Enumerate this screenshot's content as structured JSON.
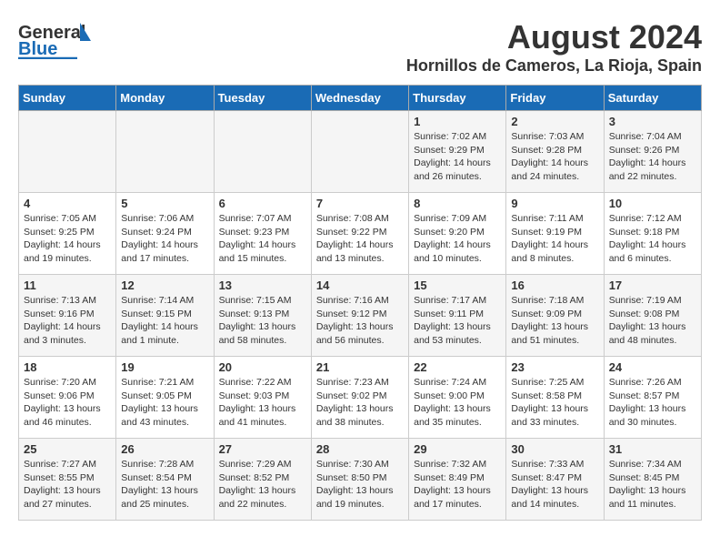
{
  "header": {
    "logo_general": "General",
    "logo_blue": "Blue",
    "title": "August 2024",
    "subtitle": "Hornillos de Cameros, La Rioja, Spain"
  },
  "weekdays": [
    "Sunday",
    "Monday",
    "Tuesday",
    "Wednesday",
    "Thursday",
    "Friday",
    "Saturday"
  ],
  "weeks": [
    [
      {
        "day": "",
        "info": ""
      },
      {
        "day": "",
        "info": ""
      },
      {
        "day": "",
        "info": ""
      },
      {
        "day": "",
        "info": ""
      },
      {
        "day": "1",
        "info": "Sunrise: 7:02 AM\nSunset: 9:29 PM\nDaylight: 14 hours\nand 26 minutes."
      },
      {
        "day": "2",
        "info": "Sunrise: 7:03 AM\nSunset: 9:28 PM\nDaylight: 14 hours\nand 24 minutes."
      },
      {
        "day": "3",
        "info": "Sunrise: 7:04 AM\nSunset: 9:26 PM\nDaylight: 14 hours\nand 22 minutes."
      }
    ],
    [
      {
        "day": "4",
        "info": "Sunrise: 7:05 AM\nSunset: 9:25 PM\nDaylight: 14 hours\nand 19 minutes."
      },
      {
        "day": "5",
        "info": "Sunrise: 7:06 AM\nSunset: 9:24 PM\nDaylight: 14 hours\nand 17 minutes."
      },
      {
        "day": "6",
        "info": "Sunrise: 7:07 AM\nSunset: 9:23 PM\nDaylight: 14 hours\nand 15 minutes."
      },
      {
        "day": "7",
        "info": "Sunrise: 7:08 AM\nSunset: 9:22 PM\nDaylight: 14 hours\nand 13 minutes."
      },
      {
        "day": "8",
        "info": "Sunrise: 7:09 AM\nSunset: 9:20 PM\nDaylight: 14 hours\nand 10 minutes."
      },
      {
        "day": "9",
        "info": "Sunrise: 7:11 AM\nSunset: 9:19 PM\nDaylight: 14 hours\nand 8 minutes."
      },
      {
        "day": "10",
        "info": "Sunrise: 7:12 AM\nSunset: 9:18 PM\nDaylight: 14 hours\nand 6 minutes."
      }
    ],
    [
      {
        "day": "11",
        "info": "Sunrise: 7:13 AM\nSunset: 9:16 PM\nDaylight: 14 hours\nand 3 minutes."
      },
      {
        "day": "12",
        "info": "Sunrise: 7:14 AM\nSunset: 9:15 PM\nDaylight: 14 hours\nand 1 minute."
      },
      {
        "day": "13",
        "info": "Sunrise: 7:15 AM\nSunset: 9:13 PM\nDaylight: 13 hours\nand 58 minutes."
      },
      {
        "day": "14",
        "info": "Sunrise: 7:16 AM\nSunset: 9:12 PM\nDaylight: 13 hours\nand 56 minutes."
      },
      {
        "day": "15",
        "info": "Sunrise: 7:17 AM\nSunset: 9:11 PM\nDaylight: 13 hours\nand 53 minutes."
      },
      {
        "day": "16",
        "info": "Sunrise: 7:18 AM\nSunset: 9:09 PM\nDaylight: 13 hours\nand 51 minutes."
      },
      {
        "day": "17",
        "info": "Sunrise: 7:19 AM\nSunset: 9:08 PM\nDaylight: 13 hours\nand 48 minutes."
      }
    ],
    [
      {
        "day": "18",
        "info": "Sunrise: 7:20 AM\nSunset: 9:06 PM\nDaylight: 13 hours\nand 46 minutes."
      },
      {
        "day": "19",
        "info": "Sunrise: 7:21 AM\nSunset: 9:05 PM\nDaylight: 13 hours\nand 43 minutes."
      },
      {
        "day": "20",
        "info": "Sunrise: 7:22 AM\nSunset: 9:03 PM\nDaylight: 13 hours\nand 41 minutes."
      },
      {
        "day": "21",
        "info": "Sunrise: 7:23 AM\nSunset: 9:02 PM\nDaylight: 13 hours\nand 38 minutes."
      },
      {
        "day": "22",
        "info": "Sunrise: 7:24 AM\nSunset: 9:00 PM\nDaylight: 13 hours\nand 35 minutes."
      },
      {
        "day": "23",
        "info": "Sunrise: 7:25 AM\nSunset: 8:58 PM\nDaylight: 13 hours\nand 33 minutes."
      },
      {
        "day": "24",
        "info": "Sunrise: 7:26 AM\nSunset: 8:57 PM\nDaylight: 13 hours\nand 30 minutes."
      }
    ],
    [
      {
        "day": "25",
        "info": "Sunrise: 7:27 AM\nSunset: 8:55 PM\nDaylight: 13 hours\nand 27 minutes."
      },
      {
        "day": "26",
        "info": "Sunrise: 7:28 AM\nSunset: 8:54 PM\nDaylight: 13 hours\nand 25 minutes."
      },
      {
        "day": "27",
        "info": "Sunrise: 7:29 AM\nSunset: 8:52 PM\nDaylight: 13 hours\nand 22 minutes."
      },
      {
        "day": "28",
        "info": "Sunrise: 7:30 AM\nSunset: 8:50 PM\nDaylight: 13 hours\nand 19 minutes."
      },
      {
        "day": "29",
        "info": "Sunrise: 7:32 AM\nSunset: 8:49 PM\nDaylight: 13 hours\nand 17 minutes."
      },
      {
        "day": "30",
        "info": "Sunrise: 7:33 AM\nSunset: 8:47 PM\nDaylight: 13 hours\nand 14 minutes."
      },
      {
        "day": "31",
        "info": "Sunrise: 7:34 AM\nSunset: 8:45 PM\nDaylight: 13 hours\nand 11 minutes."
      }
    ]
  ]
}
